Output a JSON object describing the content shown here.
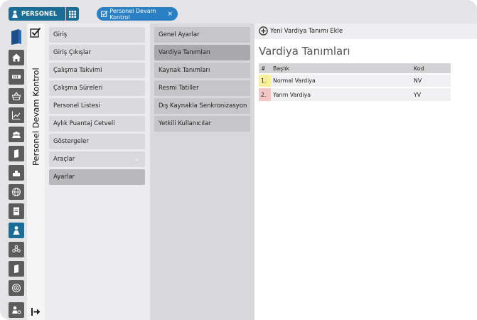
{
  "header": {
    "brand_label": "PERSONEL",
    "tab_label": "Personel Devam Kontrol",
    "tab_close": "×"
  },
  "module": {
    "title": "Personel Devam Kontrol"
  },
  "menu1": {
    "items": [
      {
        "label": "Giriş"
      },
      {
        "label": "Giriş Çıkışlar"
      },
      {
        "label": "Çalışma Takvimi"
      },
      {
        "label": "Çalışma Süreleri"
      },
      {
        "label": "Personel Listesi"
      },
      {
        "label": "Aylık Puantaj Cetveli"
      },
      {
        "label": "Göstergeler"
      },
      {
        "label": "Araçlar"
      },
      {
        "label": "Ayarlar"
      }
    ],
    "active_index": 8
  },
  "menu2": {
    "items": [
      {
        "label": "Genel Ayarlar"
      },
      {
        "label": "Vardiya Tanımları"
      },
      {
        "label": "Kaynak Tanımları"
      },
      {
        "label": "Resmi Tatiller"
      },
      {
        "label": "Dış Kaynakla Senkronizasyon"
      },
      {
        "label": "Yetkili Kullanıcılar"
      }
    ],
    "active_index": 1
  },
  "content": {
    "add_button_label": "Yeni Vardiya Tanımı Ekle",
    "title": "Vardiya Tanımları",
    "table": {
      "headers": [
        "#",
        "Başlık",
        "Kod"
      ],
      "rows": [
        {
          "num": "1.",
          "title": "Normal Vardiya",
          "code": "NV",
          "color": "#f7ef9a"
        },
        {
          "num": "2.",
          "title": "Yarım Vardiya",
          "code": "YV",
          "color": "#f4c6c6"
        }
      ]
    }
  },
  "rail": {
    "icons": [
      "home-icon",
      "card-icon",
      "basket-icon",
      "chart-icon",
      "people-icon",
      "book-icon",
      "building-icon",
      "globe-icon",
      "notebook-icon",
      "person-icon",
      "flower-icon",
      "book2-icon",
      "target-icon"
    ],
    "active": "person-icon",
    "bottom": "user-settings-icon"
  },
  "colors": {
    "brand": "#1b6d96",
    "tab": "#2a80c2"
  }
}
